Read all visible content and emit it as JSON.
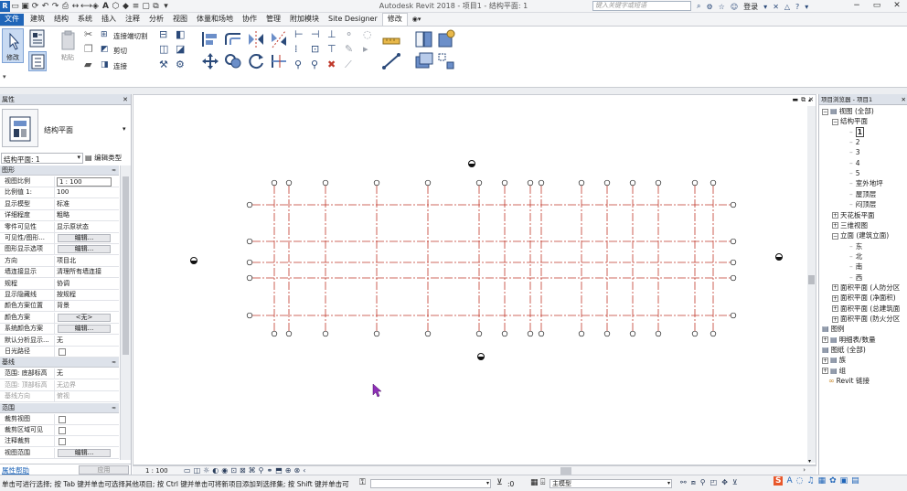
{
  "app": {
    "title": "Autodesk Revit 2018 -  项目1 - 结构平面: 1",
    "search_placeholder": "键入关键字或短语",
    "user": "登录",
    "accent": "#1f65b8"
  },
  "tabs": [
    "文件",
    "建筑",
    "结构",
    "系统",
    "插入",
    "注释",
    "分析",
    "视图",
    "体量和场地",
    "协作",
    "管理",
    "附加模块",
    "Site Designer",
    "修改"
  ],
  "active_tab": "修改",
  "ribbon": {
    "modify_label": "修改",
    "paste_label": "粘贴",
    "cope_label": "连接端切割",
    "cut_label": "剪切",
    "join_label": "连接"
  },
  "properties": {
    "header": "属性",
    "type_name": "结构平面",
    "instance_selector": "结构平面: 1",
    "edit_type": "编辑类型",
    "help_link": "属性帮助",
    "apply": "应用",
    "sections": [
      {
        "name": "图形",
        "toggle": "≈"
      },
      {
        "name": "基线",
        "toggle": "≈"
      },
      {
        "name": "范围",
        "toggle": "≈"
      }
    ],
    "graphics_rows": [
      {
        "k": "视图比例",
        "v": "1 : 100",
        "kind": "input"
      },
      {
        "k": "比例值 1:",
        "v": "100"
      },
      {
        "k": "显示模型",
        "v": "标准"
      },
      {
        "k": "详细程度",
        "v": "粗略"
      },
      {
        "k": "零件可见性",
        "v": "显示原状态"
      },
      {
        "k": "可见性/图形...",
        "v": "编辑...",
        "kind": "button"
      },
      {
        "k": "图形显示选项",
        "v": "编辑...",
        "kind": "button"
      },
      {
        "k": "方向",
        "v": "项目北"
      },
      {
        "k": "墙连接显示",
        "v": "清理所有墙连接"
      },
      {
        "k": "规程",
        "v": "协调"
      },
      {
        "k": "显示隐藏线",
        "v": "按规程"
      },
      {
        "k": "颜色方案位置",
        "v": "背景"
      },
      {
        "k": "颜色方案",
        "v": "<无>",
        "kind": "button"
      },
      {
        "k": "系统颜色方案",
        "v": "编辑...",
        "kind": "button"
      },
      {
        "k": "默认分析显示...",
        "v": "无"
      },
      {
        "k": "日光路径",
        "v": "",
        "kind": "checkbox"
      }
    ],
    "underlay_rows": [
      {
        "k": "范围: 底部标高",
        "v": "无"
      },
      {
        "k": "范围: 顶部标高",
        "v": "无边界",
        "muted": true
      },
      {
        "k": "基线方向",
        "v": "俯视",
        "muted": true
      }
    ],
    "extents_rows": [
      {
        "k": "裁剪视图",
        "v": "",
        "kind": "checkbox"
      },
      {
        "k": "裁剪区域可见",
        "v": "",
        "kind": "checkbox"
      },
      {
        "k": "注释裁剪",
        "v": "",
        "kind": "checkbox"
      },
      {
        "k": "视图范围",
        "v": "编辑...",
        "kind": "button"
      }
    ]
  },
  "browser": {
    "header": "项目浏览器 - 项目1",
    "nodes": [
      {
        "label": "视图 (全部)",
        "depth": 0,
        "toggle": "−"
      },
      {
        "label": "结构平面",
        "depth": 1,
        "toggle": "−"
      },
      {
        "label": "1",
        "depth": 2,
        "bold": true
      },
      {
        "label": "2",
        "depth": 2
      },
      {
        "label": "3",
        "depth": 2
      },
      {
        "label": "4",
        "depth": 2
      },
      {
        "label": "5",
        "depth": 2
      },
      {
        "label": "室外地坪",
        "depth": 2
      },
      {
        "label": "屋顶层",
        "depth": 2
      },
      {
        "label": "闷顶层",
        "depth": 2
      },
      {
        "label": "天花板平面",
        "depth": 1,
        "toggle": "+"
      },
      {
        "label": "三维视图",
        "depth": 1,
        "toggle": "+"
      },
      {
        "label": "立面 (建筑立面)",
        "depth": 1,
        "toggle": "−"
      },
      {
        "label": "东",
        "depth": 2
      },
      {
        "label": "北",
        "depth": 2
      },
      {
        "label": "南",
        "depth": 2
      },
      {
        "label": "西",
        "depth": 2
      },
      {
        "label": "面积平面 (人防分区",
        "depth": 1,
        "toggle": "+"
      },
      {
        "label": "面积平面 (净面积)",
        "depth": 1,
        "toggle": "+"
      },
      {
        "label": "面积平面 (总建筑面",
        "depth": 1,
        "toggle": "+"
      },
      {
        "label": "面积平面 (防火分区",
        "depth": 1,
        "toggle": "+"
      },
      {
        "label": "图例",
        "depth": 0,
        "icon": true
      },
      {
        "label": "明细表/数量",
        "depth": 0,
        "toggle": "+",
        "icon": true
      },
      {
        "label": "图纸 (全部)",
        "depth": 0,
        "icon": true
      },
      {
        "label": "族",
        "depth": 0,
        "toggle": "+",
        "icon": true
      },
      {
        "label": "组",
        "depth": 0,
        "toggle": "+",
        "icon": true
      },
      {
        "label": "Revit 链接",
        "depth": 0,
        "link": true
      }
    ]
  },
  "viewbar": {
    "scale": "1 : 100"
  },
  "status": {
    "message": "单击可进行选择; 按 Tab 键并单击可选择其他项目; 按 Ctrl 键并单击可将新项目添加到选择集; 按 Shift 键并单击可",
    "count": ":0",
    "model": "主模型"
  }
}
